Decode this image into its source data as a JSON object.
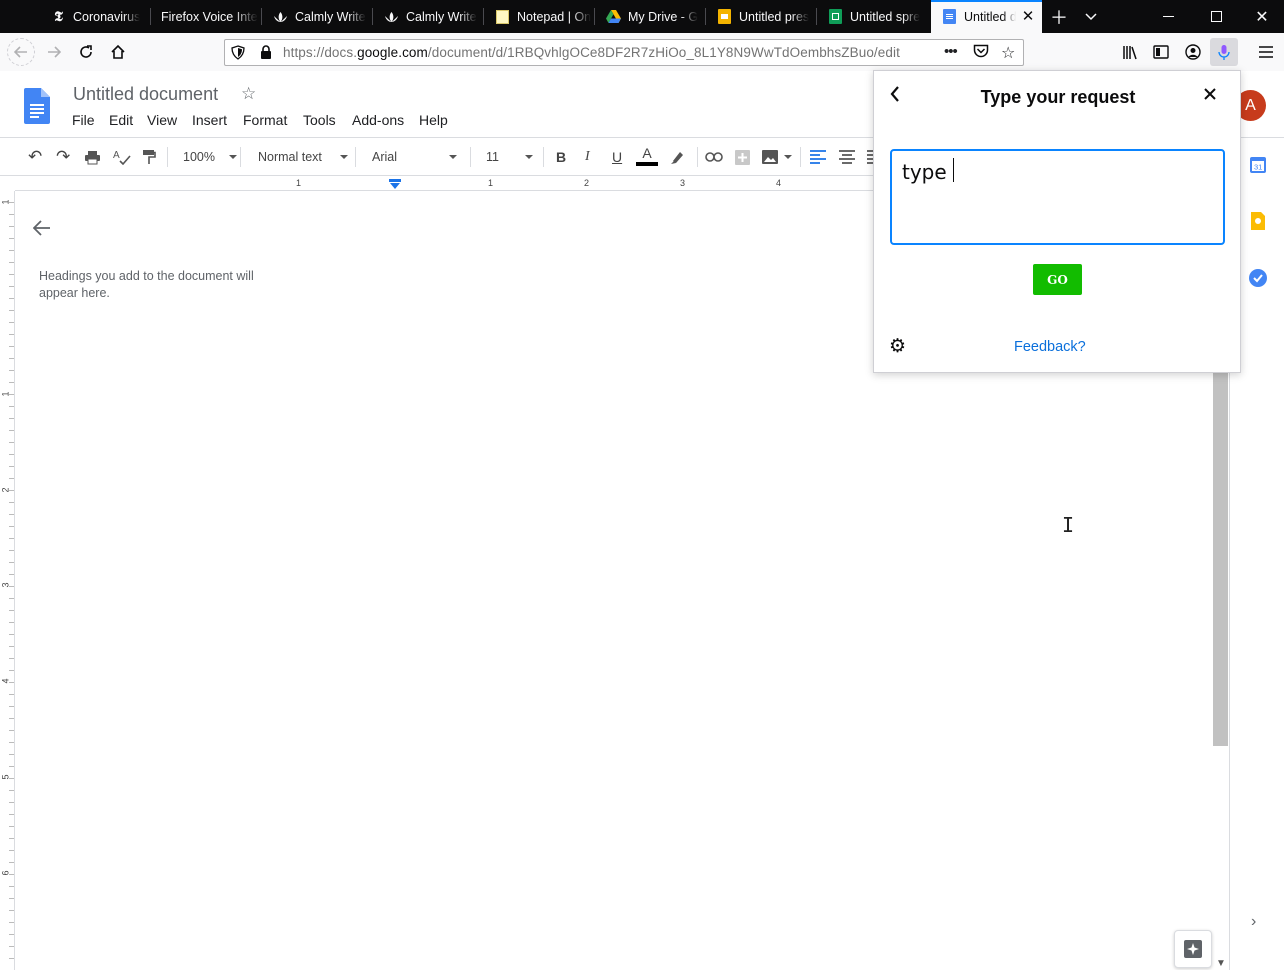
{
  "browser": {
    "tabs": [
      {
        "title": "Coronavirus",
        "icon": "nyt-icon"
      },
      {
        "title": "Firefox Voice Inte",
        "icon": "none"
      },
      {
        "title": "Calmly Write",
        "icon": "lotus-icon"
      },
      {
        "title": "Calmly Write",
        "icon": "lotus-icon"
      },
      {
        "title": "Notepad | On",
        "icon": "notepad-icon"
      },
      {
        "title": "My Drive - G",
        "icon": "drive-icon"
      },
      {
        "title": "Untitled pres",
        "icon": "slides-icon"
      },
      {
        "title": "Untitled spre",
        "icon": "sheets-icon"
      },
      {
        "title": "Untitled d",
        "icon": "docs-icon",
        "active": true
      }
    ],
    "url_prefix": "https://docs.",
    "url_domain": "google.com",
    "url_path": "/document/d/1RBQvhlgOCe8DF2R7zHiOo_8L1Y8N9WwTdOembhsZBuo/edit",
    "accent": "#0a84ff"
  },
  "docs": {
    "title": "Untitled document",
    "menu": [
      "File",
      "Edit",
      "View",
      "Insert",
      "Format",
      "Tools",
      "Add-ons",
      "Help"
    ],
    "avatar_initial": "A",
    "toolbar": {
      "zoom": "100%",
      "style": "Normal text",
      "font": "Arial",
      "size": "11"
    },
    "ruler_marks": [
      "1",
      "1",
      "2",
      "3",
      "4"
    ],
    "vruler_marks": [
      "1",
      "1",
      "2",
      "3",
      "4",
      "5",
      "6"
    ],
    "outline_hint": "Headings you add to the document will appear here."
  },
  "voice_popup": {
    "title": "Type your request",
    "input_value": "type ",
    "go_label": "GO",
    "feedback_label": "Feedback?",
    "go_color": "#12bc00"
  }
}
